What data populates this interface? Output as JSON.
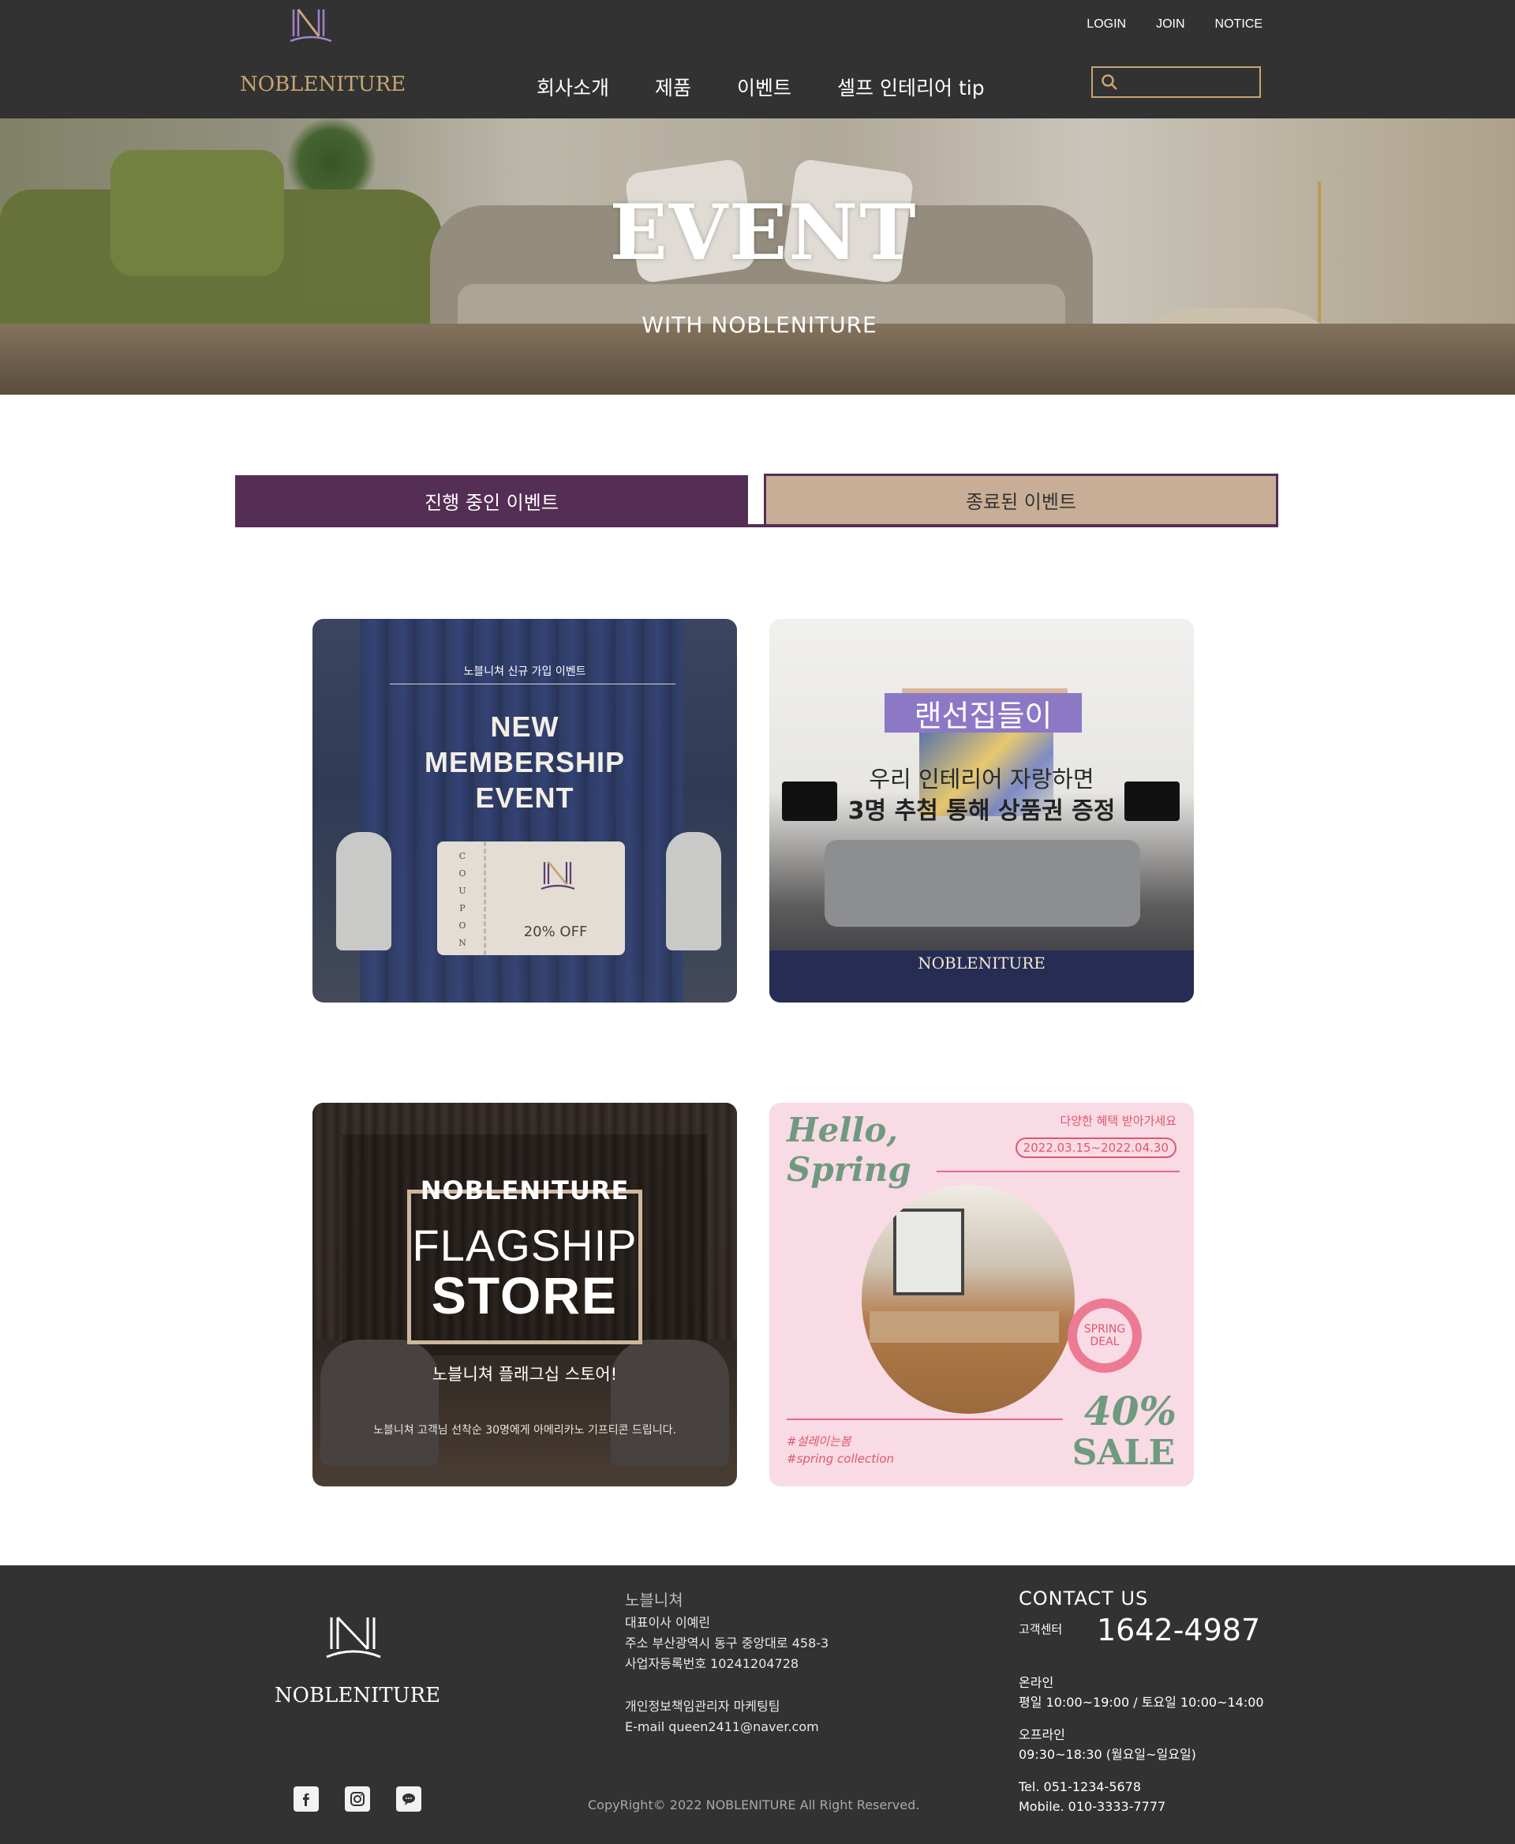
{
  "header": {
    "logo_text": "NOBLENITURE",
    "top_links": [
      "LOGIN",
      "JOIN",
      "NOTICE"
    ],
    "nav": [
      "회사소개",
      "제품",
      "이벤트",
      "셀프 인테리어 tip"
    ],
    "search_placeholder": ""
  },
  "hero": {
    "title": "EVENT",
    "subtitle": "WITH NOBLENITURE"
  },
  "tabs": {
    "active": "진행 중인 이벤트",
    "ended": "종료된 이벤트"
  },
  "cards": {
    "membership": {
      "subtitle": "노블니쳐 신규 가입 이벤트",
      "title_lines": [
        "NEW",
        "MEMBERSHIP",
        "EVENT"
      ],
      "coupon_vertical": "COUPON",
      "discount": "20% OFF"
    },
    "housewarming": {
      "heading": "랜선집들이",
      "line1": "우리 인테리어 자랑하면",
      "line2": "3명 추첨 통해 상품권 증정",
      "brand": "NOBLENITURE"
    },
    "flagship": {
      "brand": "NOBLENITURE",
      "title1": "FLAGSHIP",
      "title2": "STORE",
      "korean": "노블니쳐 플래그십 스토어!",
      "note": "노블니쳐 고객님 선착순 30명에게 아메리카노 기프티콘 드립니다."
    },
    "spring": {
      "hello": "Hello,",
      "spring": "Spring",
      "offer": "다양한 혜택 받아가세요",
      "date": "2022.03.15~2022.04.30",
      "badge_line1": "SPRING",
      "badge_line2": "DEAL",
      "tag1": "#설레이는봄",
      "tag2": "#spring collection",
      "percent": "40%",
      "sale": "SALE"
    }
  },
  "footer": {
    "logo_text": "NOBLENITURE",
    "company": "노블니쳐",
    "ceo": "대표이사 이예린",
    "address": "주소 부산광역시 동구 중앙대로 458-3",
    "biz_no": "사업자등록번호 10241204728",
    "privacy": "개인정보책임관리자 마케팅팀",
    "email": "E-mail queen2411@naver.com",
    "copyright": "CopyRight© 2022 NOBLENITURE All Right Reserved.",
    "contact_title": "CONTACT US",
    "cs_label": "고객센터",
    "cs_number": "1642-4987",
    "online_label": "온라인",
    "online_hours": "평일 10:00~19:00 /  토요일 10:00~14:00",
    "offline_label": "오프라인",
    "offline_hours": "09:30~18:30 (월요일~일요일)",
    "tel": "Tel. 051-1234-5678",
    "mobile": "Mobile. 010-3333-7777",
    "social_icons": [
      "facebook-icon",
      "instagram-icon",
      "chat-icon"
    ]
  },
  "colors": {
    "header_bg": "#323232",
    "gold": "#c8a572",
    "purple": "#542e55",
    "tan": "#c8ae96",
    "pink": "#f8dbe4",
    "sage": "#6f9a80"
  }
}
